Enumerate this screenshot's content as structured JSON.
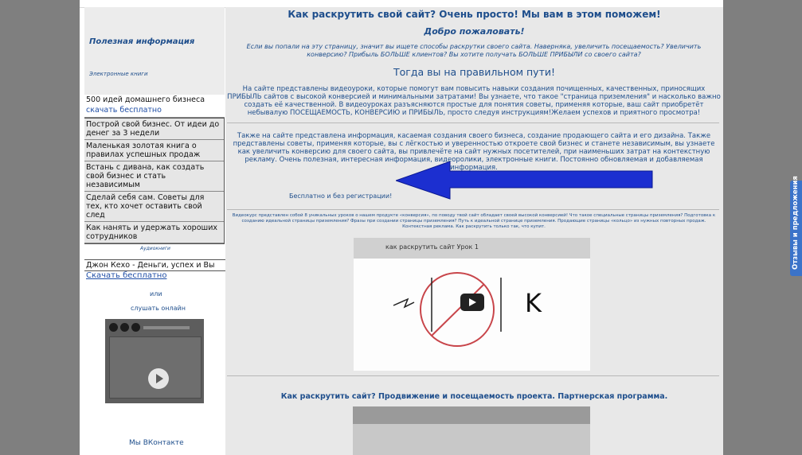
{
  "sidebar": {
    "title": "Полезная информация",
    "ebooks_label": "Электронные книги",
    "first_book": "500 идей домашнего бизнеса",
    "download_label": "скачать бесплатно",
    "books": [
      "Построй свой бизнес. От идеи до денег за 3 недели",
      "Маленькая золотая книга о правилах успешных продаж",
      "Встань с дивана, как создать свой бизнес и стать независимым",
      "Сделай себя сам. Советы для тех, кто хочет оставить свой след",
      "Как нанять и удержать хороших сотрудников"
    ],
    "audio_label": "Аудиокниги",
    "audio_item": "Джон Кехо - Деньги, успех и Вы",
    "audio_download": "Скачать бесплатно",
    "or_label": "или",
    "listen_online": "слушать онлайн",
    "vk_label": "Мы ВКонтакте"
  },
  "main": {
    "heading": "Как раскрутить свой сайт? Очень просто! Мы вам в этом поможем!",
    "welcome": "Добро пожаловать!",
    "intro": "Если вы попали на эту страницу, значит вы ищете способы раскрутки своего сайта. Наверняка, увеличить посещаемость? Увеличить конверсию? Прибыль БОЛЬШЕ клиентов? Вы хотите получать БОЛЬШЕ ПРИБЫЛИ со своего сайта?",
    "right_path": "Тогда вы на правильном пути!",
    "para1": "На сайте представлены видеоуроки, которые помогут вам повысить навыки создания почищенных, качественных, приносящих ПРИБЫЛЬ сайтов с высокой конверсией и минимальными затратами! Вы узнаете, что такое \"страница приземления\" и насколько важно создать её качественной. В видеоуроках разъясняются простые для понятия советы, применяя которые, ваш сайт приобретёт небывалую ПОСЕЩАЕМОСТЬ, КОНВЕРСИЮ и ПРИБЫЛЬ, просто следуя инструкциям!Желаем успехов и приятного просмотра!",
    "para2": "Также на сайте представлена информация, касаемая создания своего бизнеса, создание продающего сайта и его дизайна. Также представлены советы, применяя которые, вы с лёгкостью и уверенностью откроете свой бизнес и станете независимым, вы узнаете как увеличить конверсию для своего сайта, вы привлечёте на сайт нужных посетителей, при наименьших затрат на контекстную рекламу. Очень полезная, интересная информация, видеоролики, электронные книги. Постоянно обновляемая и добавляемая информация.",
    "free_registration": "Бесплатно и без регистрации!",
    "small_text": "Видеокурс представлен собой 8 уникальных уроков о нашем продукте «конверсия», по поводу твой сайт обладает своей высокой конверсией! Что такое специальные страницы приземления? Подготовка к созданию идеальной страницы приземления? Фразы при создании страницы приземления? Путь к идеальной странице приземления. Продающие страницы «кольцо» из нужных повторных продаж. Контекстная реклама. Как раскрутить только так, что купит.",
    "video1_title": "как раскрутить сайт Урок 1",
    "section2_title": "Как раскрутить сайт? Продвижение и посещаемость проекта. Партнерская программа."
  },
  "feedback_label": "Отзывы и предложения",
  "colors": {
    "accent": "#1e4e8c",
    "arrow": "#1c2fd0",
    "feedback": "#3b73c9"
  }
}
